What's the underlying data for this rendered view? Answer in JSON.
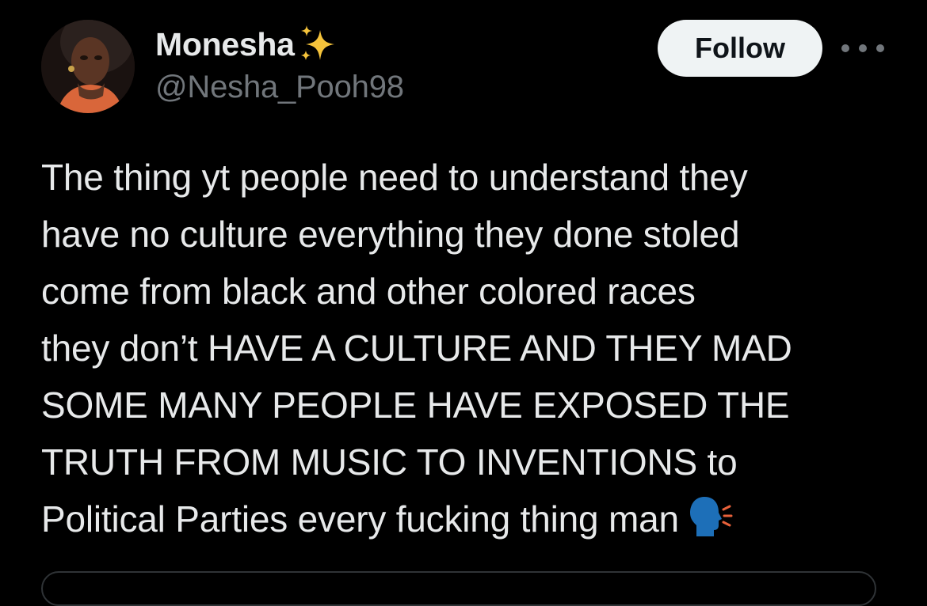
{
  "user": {
    "display_name": "Monesha",
    "name_emoji": "sparkles-icon",
    "handle": "@Nesha_Pooh98"
  },
  "actions": {
    "follow_label": "Follow",
    "more_icon": "more-horizontal-icon"
  },
  "tweet": {
    "lines": [
      "The thing yt people need to understand they",
      "have no culture everything they done stoled",
      "come from black and other colored races",
      "they don’t HAVE A CULTURE AND THEY MAD",
      "SOME MANY PEOPLE HAVE EXPOSED THE",
      "TRUTH FROM MUSIC TO INVENTIONS to",
      "Political Parties every fucking thing man"
    ],
    "trailing_emoji": "speaking-head-icon"
  },
  "colors": {
    "background": "#000000",
    "text_primary": "#e7e9ea",
    "text_secondary": "#71767b",
    "follow_bg": "#eff3f4",
    "follow_text": "#0f1419",
    "sparkle": "#f5c33b",
    "speaking_head": "#1d6fb8"
  }
}
